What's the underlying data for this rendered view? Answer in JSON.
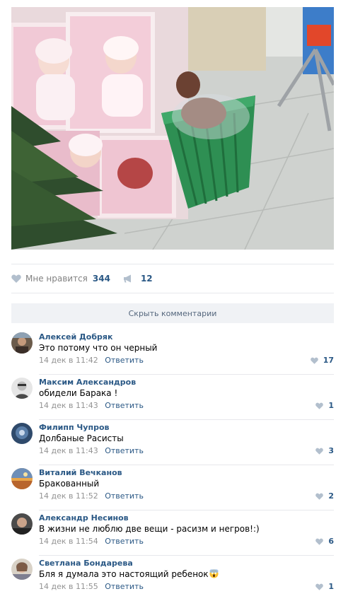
{
  "post": {
    "photo_icon": "photo",
    "likes_label": "Мне нравится",
    "likes_count": "344",
    "likes_icon": "heart-icon",
    "shares_count": "12",
    "shares_icon": "megaphone-icon"
  },
  "comments_toggle": {
    "label": "Скрыть комментарии"
  },
  "colors": {
    "link": "#2a5885",
    "muted": "#939393",
    "toggle_bg": "#f0f2f5",
    "toggle_text": "#55677d",
    "separator": "#e7e8ec"
  },
  "comments": [
    {
      "author": "Алексей Добряк",
      "text": "Это потому что он черный",
      "date": "14 дек в 11:42",
      "reply": "Ответить",
      "likes": "17"
    },
    {
      "author": "Максим Александров",
      "text": "обидели Барака !",
      "date": "14 дек в 11:43",
      "reply": "Ответить",
      "likes": "1"
    },
    {
      "author": "Филипп Чупров",
      "text": "Долбаные Расисты",
      "date": "14 дек в 11:43",
      "reply": "Ответить",
      "likes": "3"
    },
    {
      "author": "Виталий Вечканов",
      "text": "Бракованный",
      "date": "14 дек в 11:52",
      "reply": "Ответить",
      "likes": "2"
    },
    {
      "author": "Александр Несинов",
      "text": "В жизни не люблю две вещи - расизм и негров!:)",
      "date": "14 дек в 11:54",
      "reply": "Ответить",
      "likes": "6"
    },
    {
      "author": "Светлана Бондарева",
      "text": "Бля я думала это настоящий ребенок",
      "text_emoji": "screaming-face",
      "date": "14 дек в 11:55",
      "reply": "Ответить",
      "likes": "1"
    }
  ]
}
